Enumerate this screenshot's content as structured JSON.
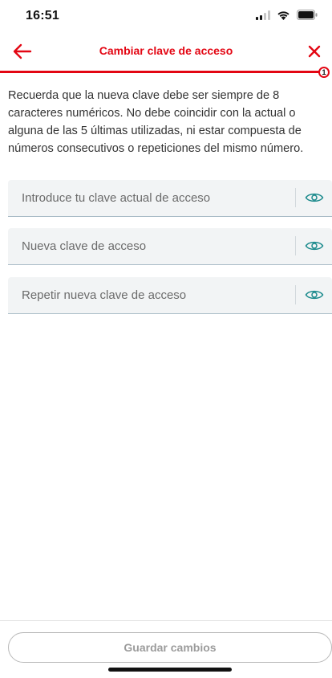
{
  "status_bar": {
    "time": "16:51",
    "icons": [
      "signal-icon",
      "wifi-icon",
      "battery-icon"
    ]
  },
  "header": {
    "title": "Cambiar clave de acceso",
    "back_icon": "arrow-left-icon",
    "close_icon": "close-icon"
  },
  "progress": {
    "step": "1",
    "fraction": 1.0
  },
  "info": {
    "text": "Recuerda que la nueva clave debe ser siempre de 8 caracteres numéricos. No debe coincidir con la actual o alguna de las 5 últimas utilizadas, ni estar compuesta de números consecutivos o repeticiones del mismo número."
  },
  "form": {
    "fields": [
      {
        "placeholder": "Introduce tu clave actual de acceso",
        "value": "",
        "icon": "eye-icon"
      },
      {
        "placeholder": "Nueva clave de acceso",
        "value": "",
        "icon": "eye-icon"
      },
      {
        "placeholder": "Repetir nueva clave de acceso",
        "value": "",
        "icon": "eye-icon"
      }
    ]
  },
  "actions": {
    "save_label": "Guardar cambios"
  },
  "colors": {
    "accent": "#e30613",
    "field_bg": "#f2f4f5",
    "eye": "#1b8a8c",
    "disabled_text": "#9b9b9b"
  }
}
